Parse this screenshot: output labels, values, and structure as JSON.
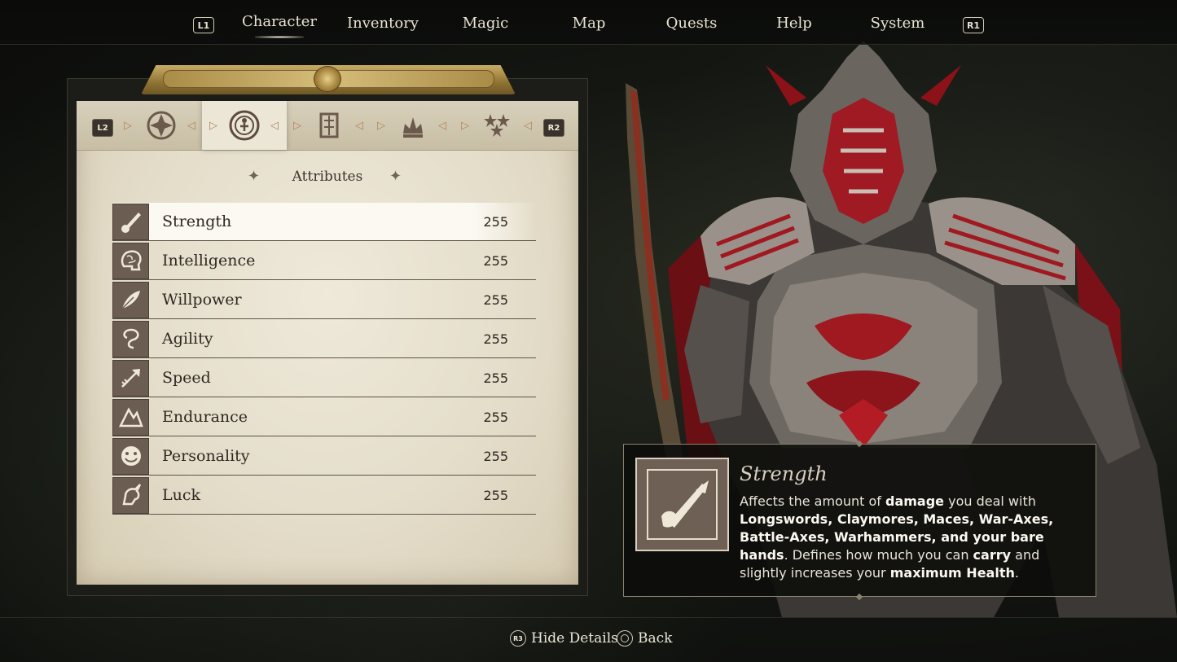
{
  "nav": {
    "left_button": "L1",
    "right_button": "R1",
    "tabs": [
      "Character",
      "Inventory",
      "Magic",
      "Map",
      "Quests",
      "Help",
      "System"
    ],
    "active_tab": "Character"
  },
  "category_bar": {
    "left_button": "L2",
    "right_button": "R2",
    "tabs": [
      {
        "icon": "emblem-icon"
      },
      {
        "icon": "serpent-rune-icon",
        "active": true
      },
      {
        "icon": "scroll-icon"
      },
      {
        "icon": "crown-icon"
      },
      {
        "icon": "star-cluster-icon"
      }
    ]
  },
  "section": {
    "title": "Attributes"
  },
  "attributes": [
    {
      "name": "Strength",
      "value": "255",
      "icon": "sword-hand-icon"
    },
    {
      "name": "Intelligence",
      "value": "255",
      "icon": "brain-icon"
    },
    {
      "name": "Willpower",
      "value": "255",
      "icon": "feather-icon"
    },
    {
      "name": "Agility",
      "value": "255",
      "icon": "swirl-icon"
    },
    {
      "name": "Speed",
      "value": "255",
      "icon": "arrow-icon"
    },
    {
      "name": "Endurance",
      "value": "255",
      "icon": "mountain-icon"
    },
    {
      "name": "Personality",
      "value": "255",
      "icon": "mask-icon"
    },
    {
      "name": "Luck",
      "value": "255",
      "icon": "unicorn-icon"
    }
  ],
  "selected_attribute": "Strength",
  "detail": {
    "title": "Strength",
    "desc_1": "Affects the amount of ",
    "desc_b1": "damage",
    "desc_2": " you deal with ",
    "desc_b2": "Longswords, Claymores, Maces, War-Axes, Battle-Axes, Warhammers, and your bare hands",
    "desc_3": ". Defines how much you can ",
    "desc_b3": "carry",
    "desc_4": " and slightly increases your ",
    "desc_b4": "maximum Health",
    "desc_5": "."
  },
  "footer": {
    "hide_badge": "R3",
    "hide_label": "Hide Details",
    "back_label": "Back"
  },
  "colors": {
    "parchment": "#e4ddca",
    "armor_red": "#a01820",
    "gold": "#b8994f"
  }
}
